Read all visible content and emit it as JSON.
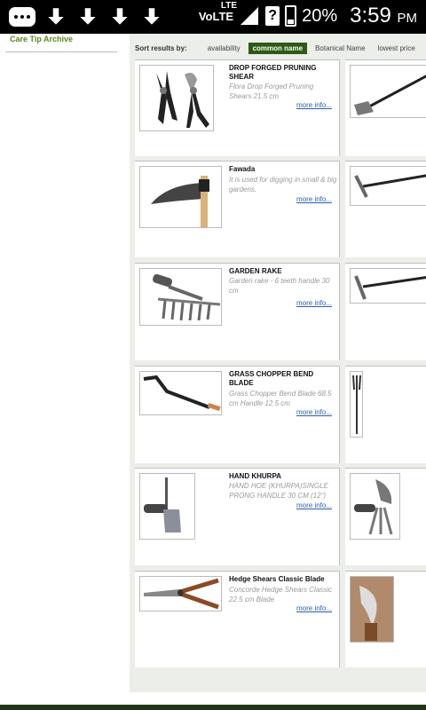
{
  "status_bar": {
    "network": "VoLTE",
    "network_sup": "LTE",
    "unknown_sim": "?",
    "battery_percent": "20%",
    "time": "3:59",
    "ampm": "PM"
  },
  "sidebar": {
    "link": "Care Tip Archive"
  },
  "sort": {
    "label": "Sort results by:",
    "options": [
      "availability",
      "common name",
      "Botanical Name",
      "lowest price"
    ],
    "active": "common name"
  },
  "products": [
    {
      "title": "DROP FORGED PRUNING SHEAR",
      "desc": "Flora Drop Forged Pruning Shears 21.5 cm",
      "more": "more info..."
    },
    {
      "title": "Fawada",
      "desc": "It is used for digging in small & big gardens.",
      "more": "more info..."
    },
    {
      "title": "GARDEN RAKE",
      "desc": "Garden rake - 6 teeth handle 30 cm",
      "more": "more info..."
    },
    {
      "title": "GRASS CHOPPER BEND BLADE",
      "desc": "Grass Chopper Bend Blade 68.5 cm Handle 12.5 cm",
      "more": "more info..."
    },
    {
      "title": "HAND KHURPA",
      "desc": "HAND HOE (KHURPA)SINGLE PRONG HANDLE 30 CM (12\")",
      "more": "more info..."
    },
    {
      "title": "Hedge Shears Classic Blade",
      "desc": "Concorde Hedge Shears Classic 22.5 cm Blade",
      "more": "more info..."
    }
  ],
  "colors": {
    "accent_green": "#2d5a14",
    "link_blue": "#2a5db0",
    "sidebar_link": "#5a8a1c"
  }
}
